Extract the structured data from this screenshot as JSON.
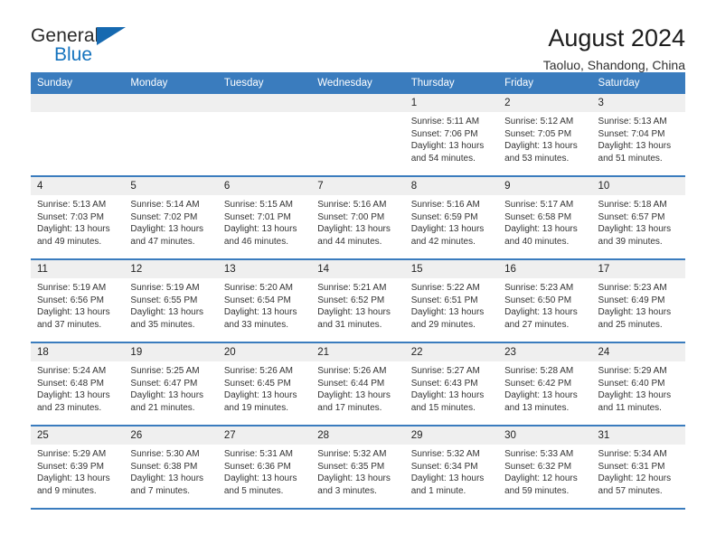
{
  "brand": {
    "name_top": "General",
    "name_bottom": "Blue",
    "triangle_color": "#1669B0",
    "blue_color": "#1573BE"
  },
  "header": {
    "title": "August 2024",
    "subtitle": "Taoluo, Shandong, China",
    "accent_color": "#3A7CBE",
    "daynum_bg": "#EFEFEF"
  },
  "weekday_headers": [
    "Sunday",
    "Monday",
    "Tuesday",
    "Wednesday",
    "Thursday",
    "Friday",
    "Saturday"
  ],
  "labels": {
    "sunrise_prefix": "Sunrise:",
    "sunset_prefix": "Sunset:",
    "daylight_prefix": "Daylight:"
  },
  "weeks": [
    [
      {
        "day": "",
        "empty": true,
        "sunrise": "",
        "sunset": "",
        "daylight_line1": "",
        "daylight_line2": ""
      },
      {
        "day": "",
        "empty": true,
        "sunrise": "",
        "sunset": "",
        "daylight_line1": "",
        "daylight_line2": ""
      },
      {
        "day": "",
        "empty": true,
        "sunrise": "",
        "sunset": "",
        "daylight_line1": "",
        "daylight_line2": ""
      },
      {
        "day": "",
        "empty": true,
        "sunrise": "",
        "sunset": "",
        "daylight_line1": "",
        "daylight_line2": ""
      },
      {
        "day": "1",
        "empty": false,
        "sunrise": "Sunrise: 5:11 AM",
        "sunset": "Sunset: 7:06 PM",
        "daylight_line1": "Daylight: 13 hours",
        "daylight_line2": "and 54 minutes."
      },
      {
        "day": "2",
        "empty": false,
        "sunrise": "Sunrise: 5:12 AM",
        "sunset": "Sunset: 7:05 PM",
        "daylight_line1": "Daylight: 13 hours",
        "daylight_line2": "and 53 minutes."
      },
      {
        "day": "3",
        "empty": false,
        "sunrise": "Sunrise: 5:13 AM",
        "sunset": "Sunset: 7:04 PM",
        "daylight_line1": "Daylight: 13 hours",
        "daylight_line2": "and 51 minutes."
      }
    ],
    [
      {
        "day": "4",
        "empty": false,
        "sunrise": "Sunrise: 5:13 AM",
        "sunset": "Sunset: 7:03 PM",
        "daylight_line1": "Daylight: 13 hours",
        "daylight_line2": "and 49 minutes."
      },
      {
        "day": "5",
        "empty": false,
        "sunrise": "Sunrise: 5:14 AM",
        "sunset": "Sunset: 7:02 PM",
        "daylight_line1": "Daylight: 13 hours",
        "daylight_line2": "and 47 minutes."
      },
      {
        "day": "6",
        "empty": false,
        "sunrise": "Sunrise: 5:15 AM",
        "sunset": "Sunset: 7:01 PM",
        "daylight_line1": "Daylight: 13 hours",
        "daylight_line2": "and 46 minutes."
      },
      {
        "day": "7",
        "empty": false,
        "sunrise": "Sunrise: 5:16 AM",
        "sunset": "Sunset: 7:00 PM",
        "daylight_line1": "Daylight: 13 hours",
        "daylight_line2": "and 44 minutes."
      },
      {
        "day": "8",
        "empty": false,
        "sunrise": "Sunrise: 5:16 AM",
        "sunset": "Sunset: 6:59 PM",
        "daylight_line1": "Daylight: 13 hours",
        "daylight_line2": "and 42 minutes."
      },
      {
        "day": "9",
        "empty": false,
        "sunrise": "Sunrise: 5:17 AM",
        "sunset": "Sunset: 6:58 PM",
        "daylight_line1": "Daylight: 13 hours",
        "daylight_line2": "and 40 minutes."
      },
      {
        "day": "10",
        "empty": false,
        "sunrise": "Sunrise: 5:18 AM",
        "sunset": "Sunset: 6:57 PM",
        "daylight_line1": "Daylight: 13 hours",
        "daylight_line2": "and 39 minutes."
      }
    ],
    [
      {
        "day": "11",
        "empty": false,
        "sunrise": "Sunrise: 5:19 AM",
        "sunset": "Sunset: 6:56 PM",
        "daylight_line1": "Daylight: 13 hours",
        "daylight_line2": "and 37 minutes."
      },
      {
        "day": "12",
        "empty": false,
        "sunrise": "Sunrise: 5:19 AM",
        "sunset": "Sunset: 6:55 PM",
        "daylight_line1": "Daylight: 13 hours",
        "daylight_line2": "and 35 minutes."
      },
      {
        "day": "13",
        "empty": false,
        "sunrise": "Sunrise: 5:20 AM",
        "sunset": "Sunset: 6:54 PM",
        "daylight_line1": "Daylight: 13 hours",
        "daylight_line2": "and 33 minutes."
      },
      {
        "day": "14",
        "empty": false,
        "sunrise": "Sunrise: 5:21 AM",
        "sunset": "Sunset: 6:52 PM",
        "daylight_line1": "Daylight: 13 hours",
        "daylight_line2": "and 31 minutes."
      },
      {
        "day": "15",
        "empty": false,
        "sunrise": "Sunrise: 5:22 AM",
        "sunset": "Sunset: 6:51 PM",
        "daylight_line1": "Daylight: 13 hours",
        "daylight_line2": "and 29 minutes."
      },
      {
        "day": "16",
        "empty": false,
        "sunrise": "Sunrise: 5:23 AM",
        "sunset": "Sunset: 6:50 PM",
        "daylight_line1": "Daylight: 13 hours",
        "daylight_line2": "and 27 minutes."
      },
      {
        "day": "17",
        "empty": false,
        "sunrise": "Sunrise: 5:23 AM",
        "sunset": "Sunset: 6:49 PM",
        "daylight_line1": "Daylight: 13 hours",
        "daylight_line2": "and 25 minutes."
      }
    ],
    [
      {
        "day": "18",
        "empty": false,
        "sunrise": "Sunrise: 5:24 AM",
        "sunset": "Sunset: 6:48 PM",
        "daylight_line1": "Daylight: 13 hours",
        "daylight_line2": "and 23 minutes."
      },
      {
        "day": "19",
        "empty": false,
        "sunrise": "Sunrise: 5:25 AM",
        "sunset": "Sunset: 6:47 PM",
        "daylight_line1": "Daylight: 13 hours",
        "daylight_line2": "and 21 minutes."
      },
      {
        "day": "20",
        "empty": false,
        "sunrise": "Sunrise: 5:26 AM",
        "sunset": "Sunset: 6:45 PM",
        "daylight_line1": "Daylight: 13 hours",
        "daylight_line2": "and 19 minutes."
      },
      {
        "day": "21",
        "empty": false,
        "sunrise": "Sunrise: 5:26 AM",
        "sunset": "Sunset: 6:44 PM",
        "daylight_line1": "Daylight: 13 hours",
        "daylight_line2": "and 17 minutes."
      },
      {
        "day": "22",
        "empty": false,
        "sunrise": "Sunrise: 5:27 AM",
        "sunset": "Sunset: 6:43 PM",
        "daylight_line1": "Daylight: 13 hours",
        "daylight_line2": "and 15 minutes."
      },
      {
        "day": "23",
        "empty": false,
        "sunrise": "Sunrise: 5:28 AM",
        "sunset": "Sunset: 6:42 PM",
        "daylight_line1": "Daylight: 13 hours",
        "daylight_line2": "and 13 minutes."
      },
      {
        "day": "24",
        "empty": false,
        "sunrise": "Sunrise: 5:29 AM",
        "sunset": "Sunset: 6:40 PM",
        "daylight_line1": "Daylight: 13 hours",
        "daylight_line2": "and 11 minutes."
      }
    ],
    [
      {
        "day": "25",
        "empty": false,
        "sunrise": "Sunrise: 5:29 AM",
        "sunset": "Sunset: 6:39 PM",
        "daylight_line1": "Daylight: 13 hours",
        "daylight_line2": "and 9 minutes."
      },
      {
        "day": "26",
        "empty": false,
        "sunrise": "Sunrise: 5:30 AM",
        "sunset": "Sunset: 6:38 PM",
        "daylight_line1": "Daylight: 13 hours",
        "daylight_line2": "and 7 minutes."
      },
      {
        "day": "27",
        "empty": false,
        "sunrise": "Sunrise: 5:31 AM",
        "sunset": "Sunset: 6:36 PM",
        "daylight_line1": "Daylight: 13 hours",
        "daylight_line2": "and 5 minutes."
      },
      {
        "day": "28",
        "empty": false,
        "sunrise": "Sunrise: 5:32 AM",
        "sunset": "Sunset: 6:35 PM",
        "daylight_line1": "Daylight: 13 hours",
        "daylight_line2": "and 3 minutes."
      },
      {
        "day": "29",
        "empty": false,
        "sunrise": "Sunrise: 5:32 AM",
        "sunset": "Sunset: 6:34 PM",
        "daylight_line1": "Daylight: 13 hours",
        "daylight_line2": "and 1 minute."
      },
      {
        "day": "30",
        "empty": false,
        "sunrise": "Sunrise: 5:33 AM",
        "sunset": "Sunset: 6:32 PM",
        "daylight_line1": "Daylight: 12 hours",
        "daylight_line2": "and 59 minutes."
      },
      {
        "day": "31",
        "empty": false,
        "sunrise": "Sunrise: 5:34 AM",
        "sunset": "Sunset: 6:31 PM",
        "daylight_line1": "Daylight: 12 hours",
        "daylight_line2": "and 57 minutes."
      }
    ]
  ]
}
